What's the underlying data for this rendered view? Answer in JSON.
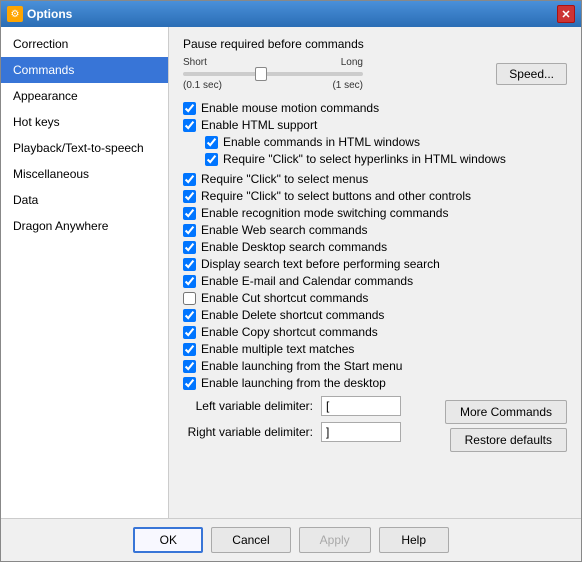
{
  "window": {
    "title": "Options",
    "close_label": "✕"
  },
  "sidebar": {
    "items": [
      {
        "id": "correction",
        "label": "Correction",
        "active": false
      },
      {
        "id": "commands",
        "label": "Commands",
        "active": true
      },
      {
        "id": "appearance",
        "label": "Appearance",
        "active": false
      },
      {
        "id": "hotkeys",
        "label": "Hot keys",
        "active": false
      },
      {
        "id": "playback",
        "label": "Playback/Text-to-speech",
        "active": false
      },
      {
        "id": "miscellaneous",
        "label": "Miscellaneous",
        "active": false
      },
      {
        "id": "data",
        "label": "Data",
        "active": false
      },
      {
        "id": "dragon-anywhere",
        "label": "Dragon Anywhere",
        "active": false
      }
    ]
  },
  "main": {
    "pause_label": "Pause required before commands",
    "slider": {
      "short_label": "Short",
      "short_sub": "(0.1 sec)",
      "long_label": "Long",
      "long_sub": "(1 sec)"
    },
    "speed_button": "Speed...",
    "checkboxes": [
      {
        "id": "mouse-motion",
        "label": "Enable mouse motion commands",
        "checked": true,
        "indent": 0
      },
      {
        "id": "html-support",
        "label": "Enable HTML support",
        "checked": true,
        "indent": 0
      },
      {
        "id": "html-commands",
        "label": "Enable commands in HTML windows",
        "checked": true,
        "indent": 1
      },
      {
        "id": "html-hyperlinks",
        "label": "Require \"Click\" to select hyperlinks in HTML windows",
        "checked": true,
        "indent": 1
      }
    ],
    "checkboxes2": [
      {
        "id": "click-menus",
        "label": "Require \"Click\" to select menus",
        "checked": true,
        "indent": 0
      },
      {
        "id": "click-buttons",
        "label": "Require \"Click\" to select buttons and other controls",
        "checked": true,
        "indent": 0
      },
      {
        "id": "recognition-mode",
        "label": "Enable recognition mode switching commands",
        "checked": true,
        "indent": 0
      },
      {
        "id": "web-search",
        "label": "Enable Web search commands",
        "checked": true,
        "indent": 0
      },
      {
        "id": "desktop-search",
        "label": "Enable Desktop search commands",
        "checked": true,
        "indent": 0
      },
      {
        "id": "display-search",
        "label": "Display search text before performing search",
        "checked": true,
        "indent": 0
      },
      {
        "id": "email-calendar",
        "label": "Enable E-mail and Calendar commands",
        "checked": true,
        "indent": 0
      },
      {
        "id": "cut-shortcut",
        "label": "Enable Cut shortcut commands",
        "checked": false,
        "indent": 0
      },
      {
        "id": "delete-shortcut",
        "label": "Enable Delete shortcut commands",
        "checked": true,
        "indent": 0
      },
      {
        "id": "copy-shortcut",
        "label": "Enable Copy shortcut commands",
        "checked": true,
        "indent": 0
      },
      {
        "id": "multiple-text",
        "label": "Enable multiple text matches",
        "checked": true,
        "indent": 0
      },
      {
        "id": "start-menu",
        "label": "Enable launching from the Start menu",
        "checked": true,
        "indent": 0
      },
      {
        "id": "desktop",
        "label": "Enable launching from the desktop",
        "checked": true,
        "indent": 0
      }
    ],
    "fields": [
      {
        "id": "left-delimiter",
        "label": "Left variable delimiter:",
        "value": "["
      },
      {
        "id": "right-delimiter",
        "label": "Right variable delimiter:",
        "value": "]"
      }
    ],
    "more_commands_btn": "More Commands",
    "restore_btn": "Restore defaults"
  },
  "footer": {
    "ok_label": "OK",
    "cancel_label": "Cancel",
    "apply_label": "Apply",
    "help_label": "Help"
  }
}
